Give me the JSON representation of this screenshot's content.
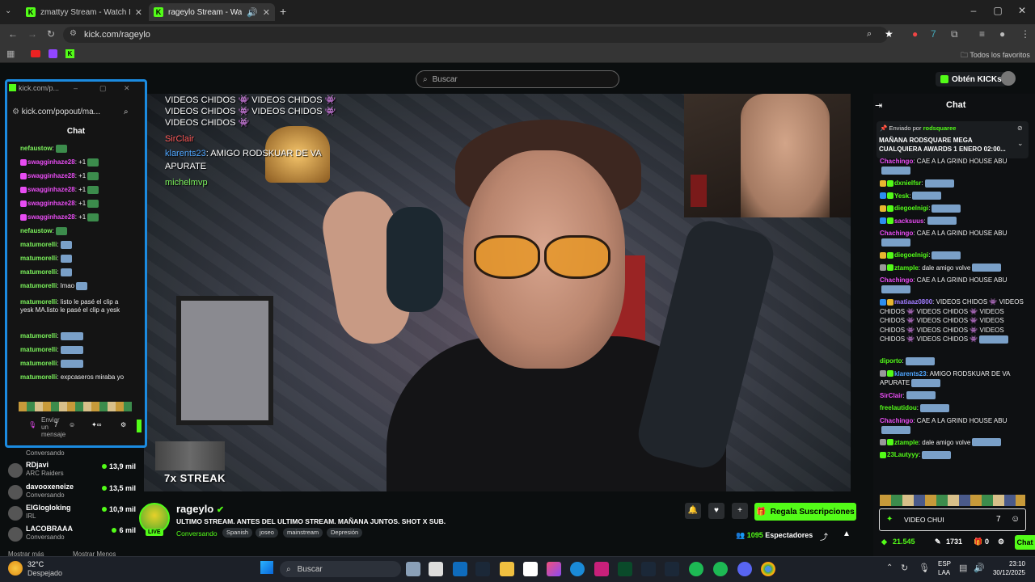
{
  "browser": {
    "tabs": [
      {
        "title": "zmattyy Stream - Watch Live o",
        "active": false
      },
      {
        "title": "rageylo Stream - Watch Live",
        "active": true
      }
    ],
    "url": "kick.com/rageylo",
    "bookmarks_label": "Todos los favoritos"
  },
  "header": {
    "search_placeholder": "Buscar",
    "get_kicks": "Obtén KICKs"
  },
  "video": {
    "overlay_lines": [
      "VIDEOS CHIDOS 👾 VIDEOS CHIDOS 👾",
      "VIDEOS CHIDOS 👾 VIDEOS CHIDOS 👾",
      "VIDEOS CHIDOS 👾"
    ],
    "overlay_user1": "SirClair",
    "overlay_user2": "klarents23",
    "overlay_msg2": ": AMIGO RODSKUAR DE VA",
    "overlay_msg2b": "APURATE",
    "overlay_user3": "michelmvp",
    "streak": "7x STREAK"
  },
  "popout": {
    "title": "kick.com/p...",
    "url": "kick.com/popout/ma...",
    "header": "Chat",
    "lines": [
      {
        "user": "nefaustow",
        "msg": ":",
        "pink": false
      },
      {
        "user": "swagginhaze28",
        "msg": ": +1",
        "pink": true
      },
      {
        "user": "swagginhaze28",
        "msg": ": +1",
        "pink": true
      },
      {
        "user": "swagginhaze28",
        "msg": ": +1",
        "pink": true
      },
      {
        "user": "swagginhaze28",
        "msg": ": +1",
        "pink": true
      },
      {
        "user": "swagginhaze28",
        "msg": ": +1",
        "pink": true
      },
      {
        "user": "nefaustow",
        "msg": ":",
        "pink": false
      },
      {
        "user": "matumorelli",
        "msg": ":",
        "pink": false
      },
      {
        "user": "matumorelli",
        "msg": ":",
        "pink": false
      },
      {
        "user": "matumorelli",
        "msg": ":",
        "pink": false
      },
      {
        "user": "matumorelli",
        "msg": ": lmao",
        "pink": false
      }
    ],
    "long_msg_user": "matumorelli",
    "long_msg_a": ": listo le pasé el clip a",
    "long_msg_b": "yesk MA.listo le pasé el clip a yesk",
    "lines2": [
      {
        "user": "matumorelli",
        "msg": ":"
      },
      {
        "user": "matumorelli",
        "msg": ":"
      },
      {
        "user": "matumorelli",
        "msg": ":"
      },
      {
        "user": "matumorelli",
        "msg": ": expcaseros miraba yo"
      }
    ],
    "input_placeholder": "Enviar un mensaje"
  },
  "sidebar": {
    "first_category": "Conversando",
    "channels": [
      {
        "name": "RDjavi",
        "category": "ARC Raiders",
        "viewers": "13,9 mil"
      },
      {
        "name": "davooxeneize",
        "category": "Conversando",
        "viewers": "13,5 mil"
      },
      {
        "name": "ElGlogloking",
        "category": "IRL",
        "viewers": "10,9 mil"
      },
      {
        "name": "LACOBRAAA",
        "category": "Conversando",
        "viewers": "6 mil"
      }
    ],
    "show_more": "Mostrar más",
    "show_less": "Mostrar Menos"
  },
  "channel": {
    "name": "rageylo",
    "live_badge": "LIVE",
    "title": "ULTIMO STREAM. ANTES DEL ULTIMO STREAM. MAÑANA JUNTOS. SHOT X SUB.",
    "category": "Conversando",
    "tags": [
      "Spanish",
      "joseo",
      "mainstream",
      "Depresión"
    ],
    "subscribe": "Regala Suscripciones",
    "viewers": "1095",
    "viewers_label": "Espectadores"
  },
  "chat": {
    "title": "Chat",
    "pinned_sender_label": "Enviado por",
    "pinned_sender": "rodsquaree",
    "pinned_text": "MAÑANA RODSQUARE MEGA CUALQUIERA AWARDS 1 ENERO 02:00...",
    "messages": [
      {
        "user": "Chachingo",
        "color": "pk",
        "msg": ": CAE A LA GRIND HOUSE ABU"
      },
      {
        "user": "dxnielfsr",
        "color": "",
        "msg": ":"
      },
      {
        "user": "Yesk",
        "color": "",
        "msg": ":"
      },
      {
        "user": "diegoelnigi",
        "color": "",
        "msg": ":"
      },
      {
        "user": "sacksuus",
        "color": "pk",
        "msg": ":"
      },
      {
        "user": "Chachingo",
        "color": "pk",
        "msg": ": CAE A LA GRIND HOUSE ABU"
      },
      {
        "user": "diegoelnigi",
        "color": "",
        "msg": ":"
      },
      {
        "user": "ztample",
        "color": "",
        "msg": ": dale amigo volve"
      },
      {
        "user": "Chachingo",
        "color": "pk",
        "msg": ": CAE A LA GRIND HOUSE ABU"
      },
      {
        "user": "matiaaz0800",
        "color": "pu",
        "msg": ": VIDEOS CHIDOS 👾 VIDEOS CHIDOS 👾 VIDEOS CHIDOS 👾 VIDEOS CHIDOS 👾 VIDEOS CHIDOS 👾 VIDEOS CHIDOS 👾 VIDEOS CHIDOS 👾 VIDEOS CHIDOS 👾 VIDEOS CHIDOS 👾"
      },
      {
        "user": "diporto",
        "color": "",
        "msg": ":"
      },
      {
        "user": "klarents23",
        "color": "bl",
        "msg": ": AMIGO RODSKUAR DE VA APURATE"
      },
      {
        "user": "SirClair",
        "color": "pk",
        "msg": ":"
      },
      {
        "user": "freelautidou",
        "color": "",
        "msg": ":"
      },
      {
        "user": "Chachingo",
        "color": "pk",
        "msg": ": CAE A LA GRIND HOUSE ABU"
      },
      {
        "user": "ztample",
        "color": "",
        "msg": ": dale amigo volve"
      },
      {
        "user": "23Lautyyy",
        "color": "",
        "msg": ":"
      }
    ],
    "input_value": "VIDEO CHUI",
    "kicks_balance": "21.545",
    "points": "1731",
    "count_zero": "0",
    "chat_button": "Chat"
  },
  "taskbar": {
    "weather_temp": "32°C",
    "weather_text": "Despejado",
    "search": "Buscar",
    "lang1": "ESP",
    "lang2": "LAA",
    "time": "23:10",
    "date": "30/12/2025"
  },
  "colors": {
    "kick_green": "#53fc18",
    "popout_border": "#1b8be0"
  }
}
